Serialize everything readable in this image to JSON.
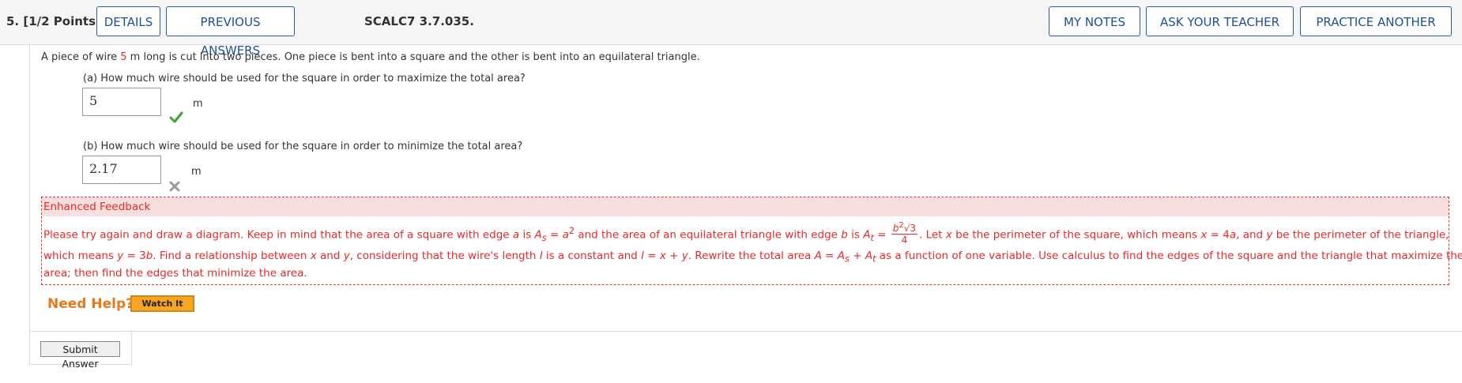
{
  "header": {
    "question_label": "5.  [1/2 Points]",
    "details_button": "DETAILS",
    "previous_answers_button": "PREVIOUS ANSWERS",
    "question_code": "SCALC7 3.7.035.",
    "my_notes_button": "MY NOTES",
    "ask_teacher_button": "ASK YOUR TEACHER",
    "practice_another_button": "PRACTICE ANOTHER"
  },
  "problem": {
    "stem_before": "A piece of wire ",
    "stem_value": "5",
    "stem_after": " m long is cut into two pieces. One piece is bent into a square and the other is bent into an equilateral triangle.",
    "part_a": {
      "question": "(a) How much wire should be used for the square in order to maximize the total area?",
      "answer": "5",
      "unit": "m",
      "status": "correct"
    },
    "part_b": {
      "question": "(b) How much wire should be used for the square in order to minimize the total area?",
      "answer": "2.17",
      "unit": "m",
      "status": "incorrect"
    }
  },
  "feedback": {
    "heading": "Enhanced Feedback",
    "line1_a": "Please try again and draw a diagram. Keep in mind that the area of a square with edge ",
    "line1_b": " is  ",
    "line1_c": " = ",
    "line1_d": "  and the area of an equilateral triangle with edge ",
    "line1_e": " is  ",
    "line1_f": " = ",
    "line1_g": ".  Let ",
    "line1_h": " be the perimeter of the square, which means  ",
    "line1_i": " = 4",
    "line1_j": ",  and ",
    "line1_k": " be the perimeter of the triangle,",
    "line2_a": "which means  ",
    "line2_b": " = 3",
    "line2_c": ".  Find a relationship between ",
    "line2_d": " and ",
    "line2_e": ", considering that the wire's length ",
    "line2_f": " is a constant and  ",
    "line2_g": " = ",
    "line2_h": " + ",
    "line2_i": ".  Rewrite the total area  ",
    "line2_j": " = ",
    "line2_k": " + ",
    "line2_l": "  as a function of one variable. Use calculus to find the edges of the square and the triangle that maximize the",
    "line3": "area; then find the edges that minimize the area.",
    "var_a": "a",
    "var_b": "b",
    "var_x": "x",
    "var_y": "y",
    "var_l": "l",
    "var_A": "A",
    "As": "A",
    "As_sub": "s",
    "At": "A",
    "At_sub": "t",
    "a_sq": "a",
    "sq_exp": "2",
    "frac_num": "b",
    "frac_num_exp": "2",
    "frac_sqrt": "√3",
    "frac_den": "4"
  },
  "help": {
    "label": "Need Help?",
    "watch_button": "Watch It"
  },
  "submit_button": "Submit Answer"
}
